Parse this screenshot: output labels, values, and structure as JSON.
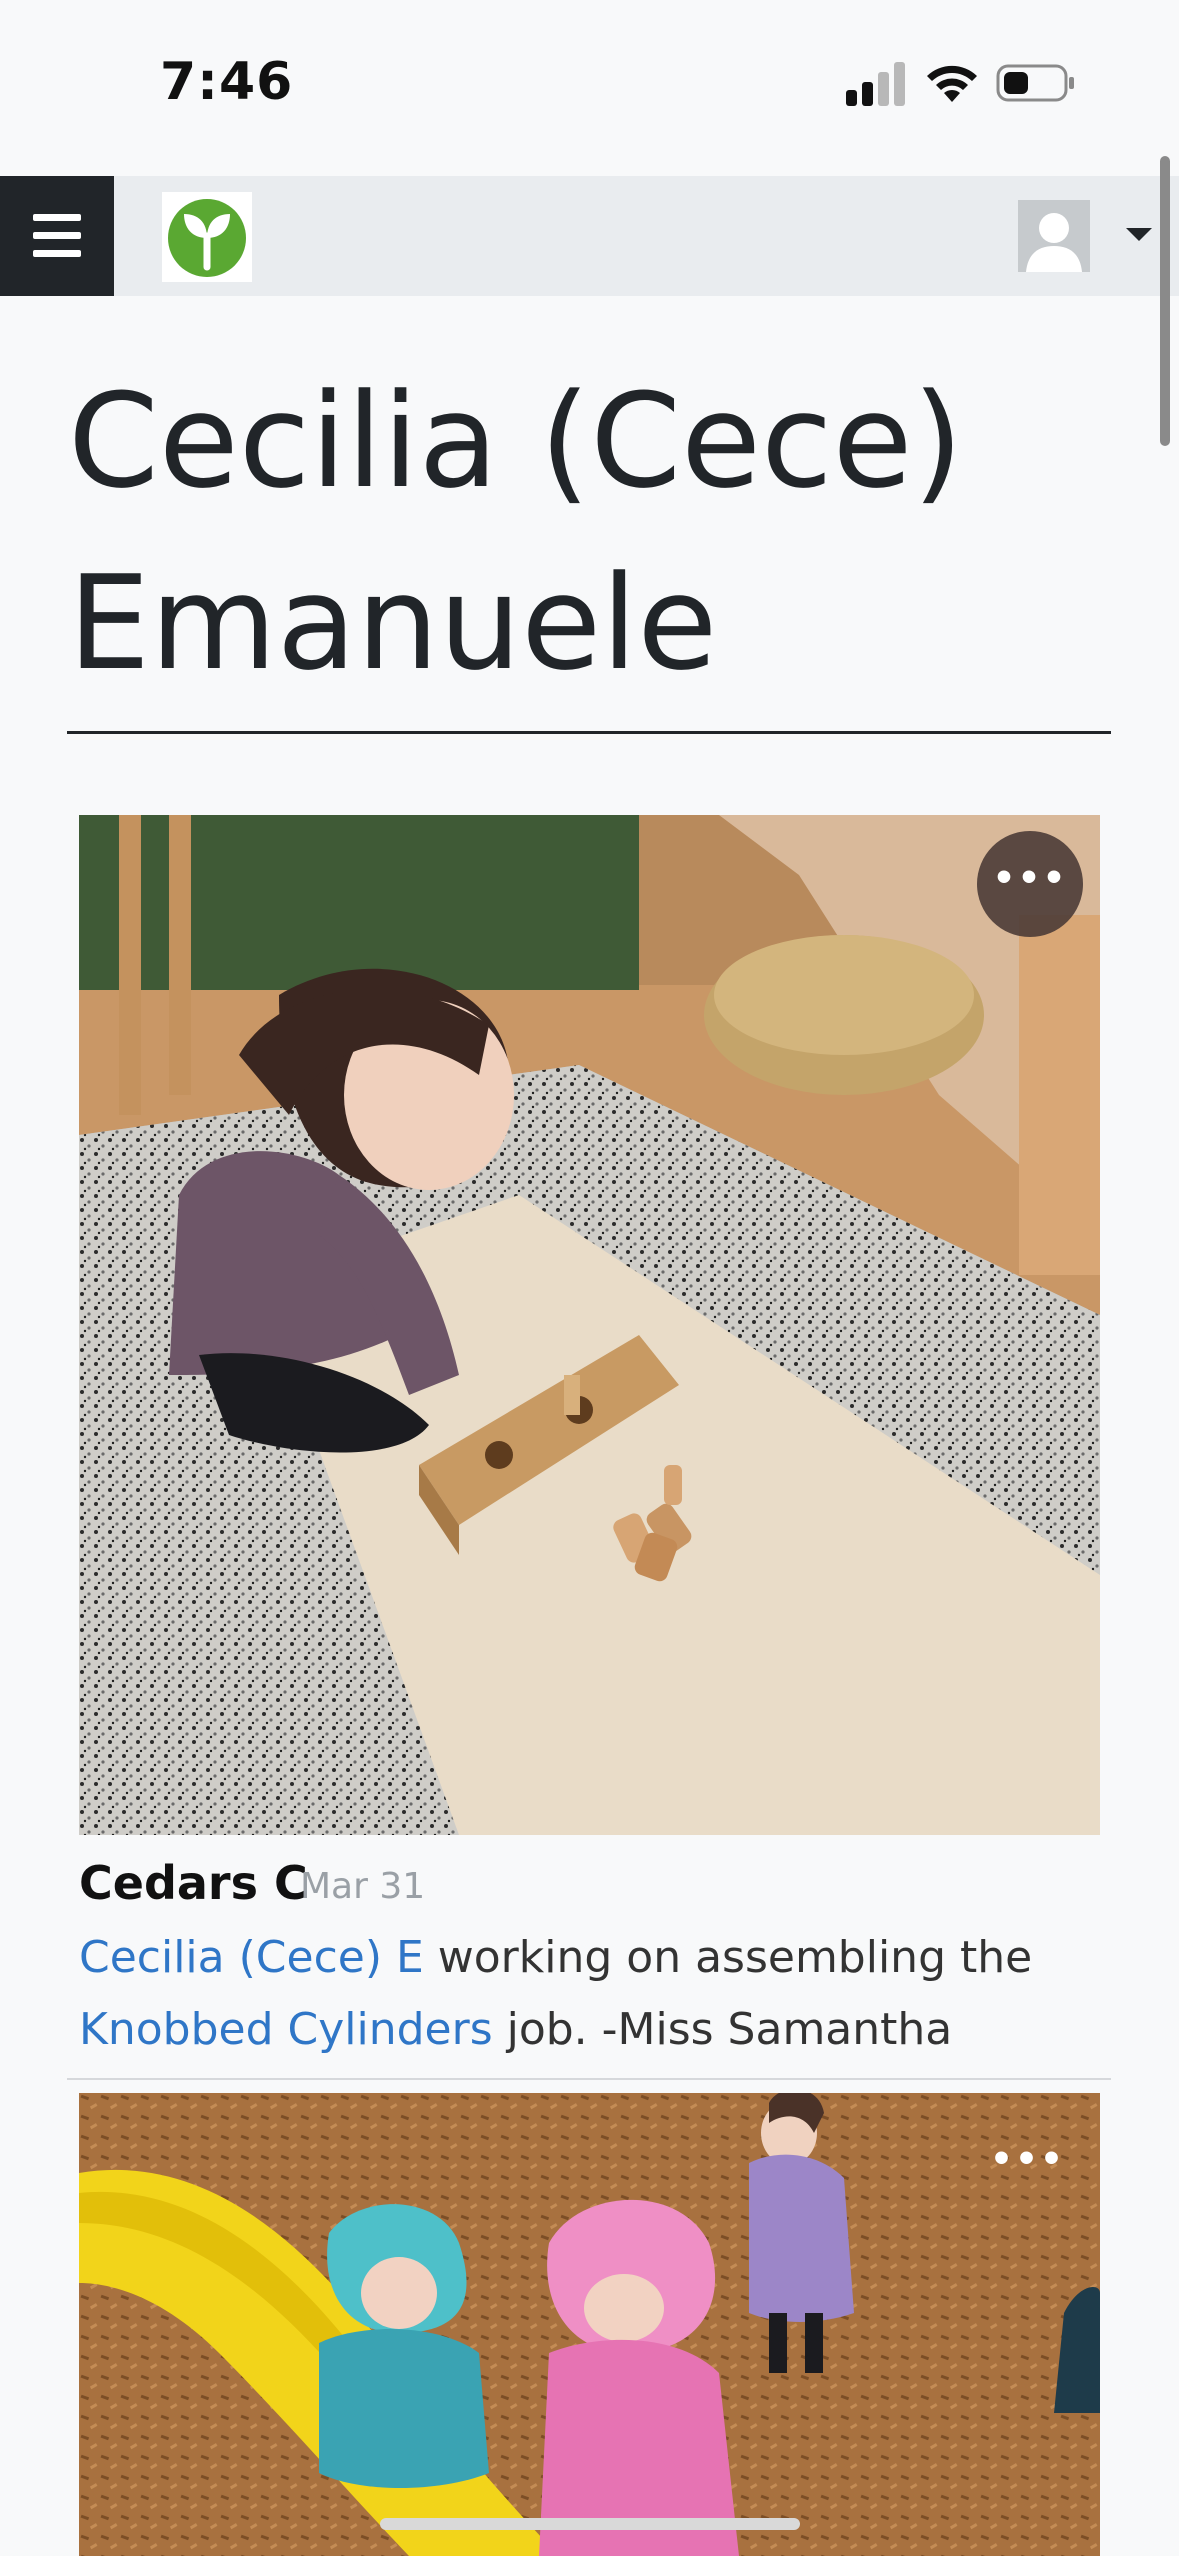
{
  "status_bar": {
    "time": "7:46"
  },
  "navbar": {
    "menu_icon": "hamburger-icon",
    "logo_icon": "sprout-logo",
    "avatar_icon": "user-avatar",
    "dropdown_icon": "caret-down-icon"
  },
  "page": {
    "title": "Cecilia (Cece) Emanuele"
  },
  "posts": [
    {
      "author": "Cedars C",
      "date": "Mar 31",
      "caption": {
        "child_link": "Cecilia (Cece) E",
        "text1": " working on assembling the ",
        "job_link": "Knobbed Cylinders",
        "text2": " job. -Miss Samantha"
      },
      "menu_label": "•••"
    },
    {
      "menu_label": "•••"
    }
  ],
  "colors": {
    "link": "#2f76c7",
    "navbar_bg": "#e9ecef",
    "menu_bg": "#212529",
    "logo_green": "#5aa832"
  }
}
